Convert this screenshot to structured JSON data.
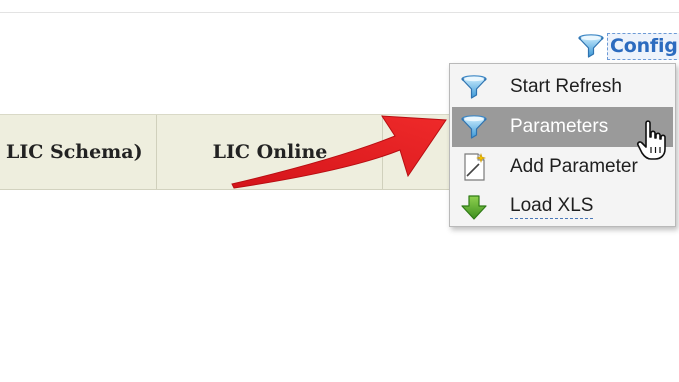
{
  "toolbar": {
    "config_label": "Config",
    "config_icon": "funnel-icon"
  },
  "table": {
    "columns": [
      {
        "label": "LIC Schema)"
      },
      {
        "label": "LIC Online"
      }
    ]
  },
  "config_menu": {
    "items": [
      {
        "label": "Start Refresh",
        "icon": "funnel-icon",
        "state": "normal"
      },
      {
        "label": "Parameters",
        "icon": "funnel-icon",
        "state": "hover"
      },
      {
        "label": "Add Parameter",
        "icon": "new-document-icon",
        "state": "normal"
      },
      {
        "label": "Load XLS",
        "icon": "green-down-arrow-icon",
        "state": "normal"
      }
    ]
  },
  "annotation": {
    "arrow_color": "#e01b1b"
  },
  "colors": {
    "config_link": "#2c6bbf",
    "menu_hover": "#9a9a9a",
    "header_bg": "#eeeede"
  }
}
